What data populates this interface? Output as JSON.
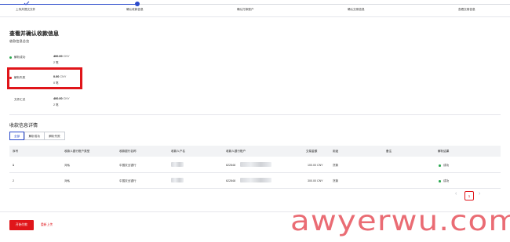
{
  "stepper": {
    "steps": [
      {
        "label": "上传并提交文件",
        "state": "done"
      },
      {
        "label": "确认收款信息",
        "state": "current"
      },
      {
        "label": "确认打款账户",
        "state": "pending"
      },
      {
        "label": "确认交易信息",
        "state": "pending"
      },
      {
        "label": "查看交易信息",
        "state": "pending"
      }
    ]
  },
  "page": {
    "title": "查看并确认收款信息",
    "summary_heading": "收款信息总览",
    "details_heading": "收款信息详情"
  },
  "summary": [
    {
      "label": "解析成功",
      "amount": "400.00",
      "currency": "CNY",
      "count": "2 笔",
      "dot_color": "#2aa94f"
    },
    {
      "label": "解析失败",
      "amount": "0.00",
      "currency": "CNY",
      "count": "0 笔",
      "dot_color": "#e0151a"
    },
    {
      "label": "文件汇总",
      "amount": "400.00",
      "currency": "CNY",
      "count": "2 笔",
      "dot_color": ""
    }
  ],
  "tabs": [
    {
      "label": "全部",
      "active": true
    },
    {
      "label": "解析成功",
      "active": false
    },
    {
      "label": "解析失败",
      "active": false
    }
  ],
  "table": {
    "columns": [
      "序号",
      "收款人银行账户类型",
      "收款银行名称",
      "收款人户名",
      "收款人银行账户",
      "交易金额",
      "用途",
      "备注",
      "解析结果"
    ],
    "rows": [
      {
        "index": "1",
        "account_type": "对私",
        "bank": "中国农业银行",
        "name": "",
        "account": "622848",
        "amount": "100.00 CNY",
        "purpose": "货款",
        "note": "",
        "result": "成功"
      },
      {
        "index": "2",
        "account_type": "对私",
        "bank": "中国农业银行",
        "name": "",
        "account": "622848",
        "amount": "300.00 CNY",
        "purpose": "货款",
        "note": "",
        "result": "成功"
      }
    ]
  },
  "pagination": {
    "prev": "‹",
    "current": "1",
    "next": "›"
  },
  "actions": {
    "primary": "开始付款",
    "secondary": "重新上传"
  },
  "watermark": "awyerwu.com",
  "colors": {
    "accent": "#2b4acb",
    "danger": "#e0151a",
    "success": "#2aa94f"
  }
}
